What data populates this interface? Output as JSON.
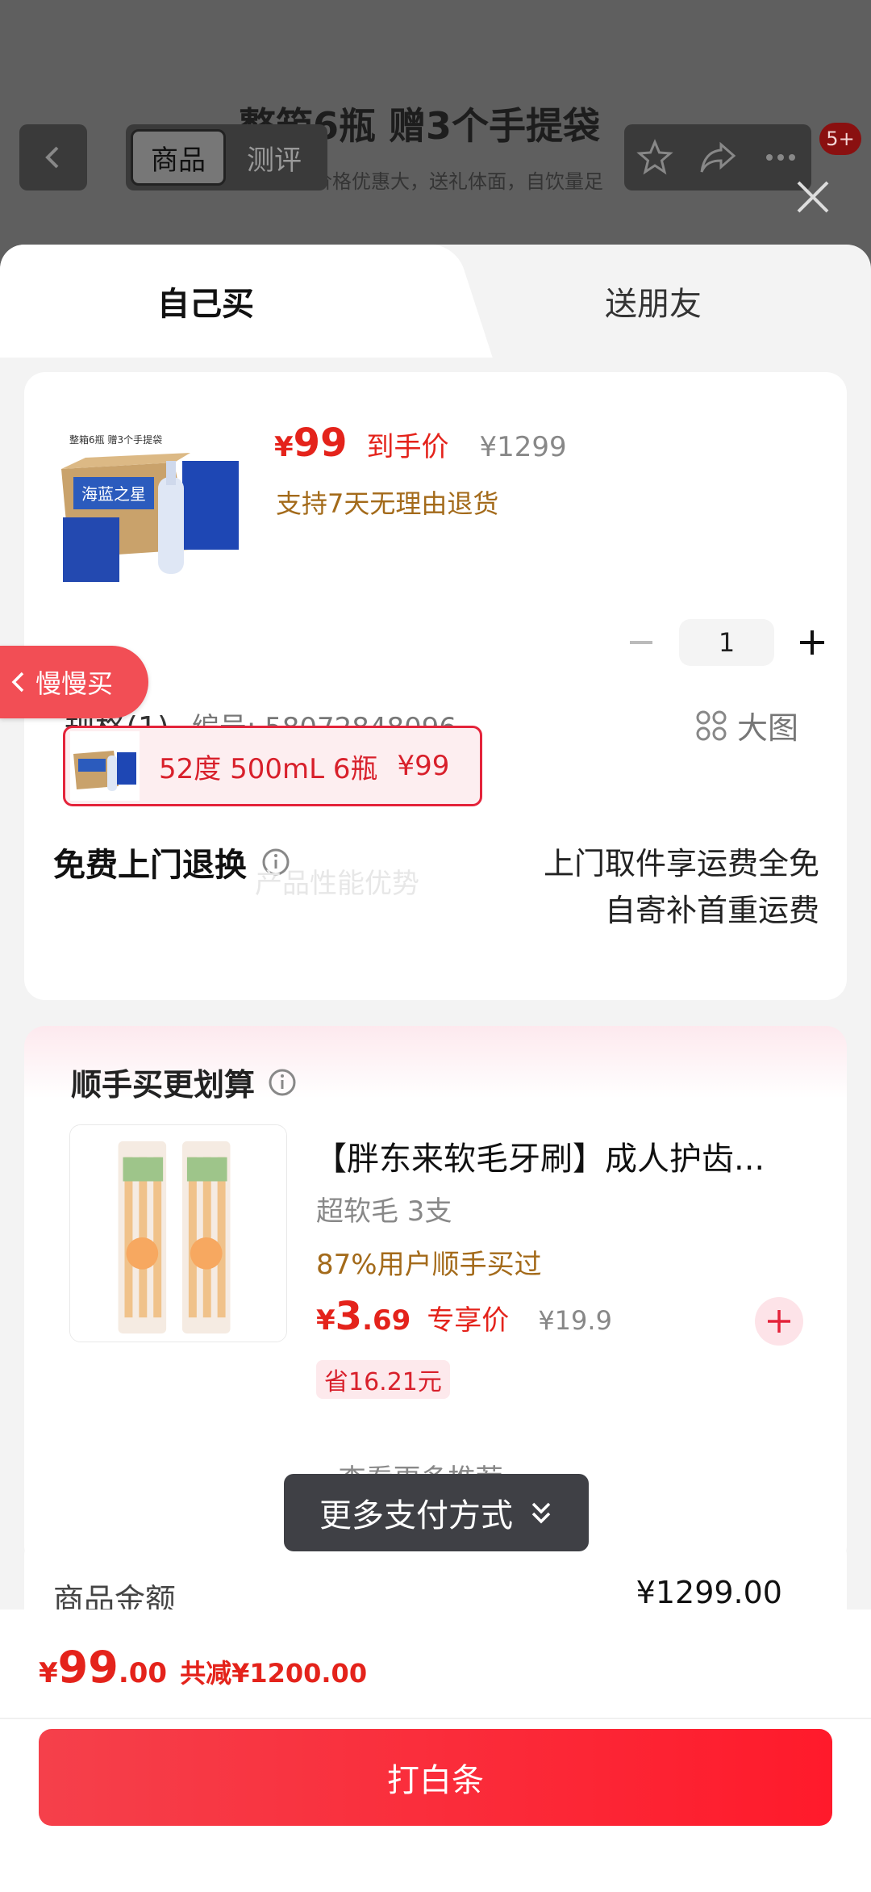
{
  "background": {
    "title": "整箱6瓶 赠3个手提袋",
    "subtitle": "整箱购买价格优惠大，送礼体面，自饮量足",
    "tabs": [
      "商品",
      "测评"
    ],
    "badge": "5+"
  },
  "sheet_tabs": {
    "self": "自己买",
    "friend": "送朋友"
  },
  "product": {
    "currency": "¥",
    "price": "99",
    "price_tag": "到手价",
    "original_price": "¥1299",
    "returns": "支持7天无理由退货",
    "quantity": "1",
    "spec_title": "规格(1)",
    "spec_code": "编号: 58072848096",
    "big_picture": "大图",
    "spec_option": "52度 500mL 6瓶",
    "spec_option_price": "¥99",
    "image_caption": "整箱6瓶 赠3个手提袋"
  },
  "free_return": {
    "title": "免费上门退换",
    "line1": "上门取件享运费全免",
    "line2": "自寄补首重运费",
    "watermark": "产品性能优势"
  },
  "addon": {
    "title": "顺手买更划算",
    "name": "【胖东来软毛牙刷】成人护齿...",
    "spec": "超软毛 3支",
    "bought": "87%用户顺手买过",
    "price_yen": "¥",
    "price_int": "3",
    "price_dec": ".69",
    "price_tag": "专享价",
    "original_price": "¥19.9",
    "save": "省16.21元",
    "more": "查看更多推荐"
  },
  "summary": {
    "label": "商品金额",
    "value": "¥1299.00"
  },
  "float_pay": "更多支付方式",
  "slow_buy": "慢慢买",
  "bottom": {
    "yen": "¥",
    "int": "99",
    "dec": ".00",
    "reduce": "共减¥1200.00",
    "pay_button": "打白条"
  },
  "colors": {
    "accent": "#e4231b",
    "gold": "#a36a1a"
  }
}
